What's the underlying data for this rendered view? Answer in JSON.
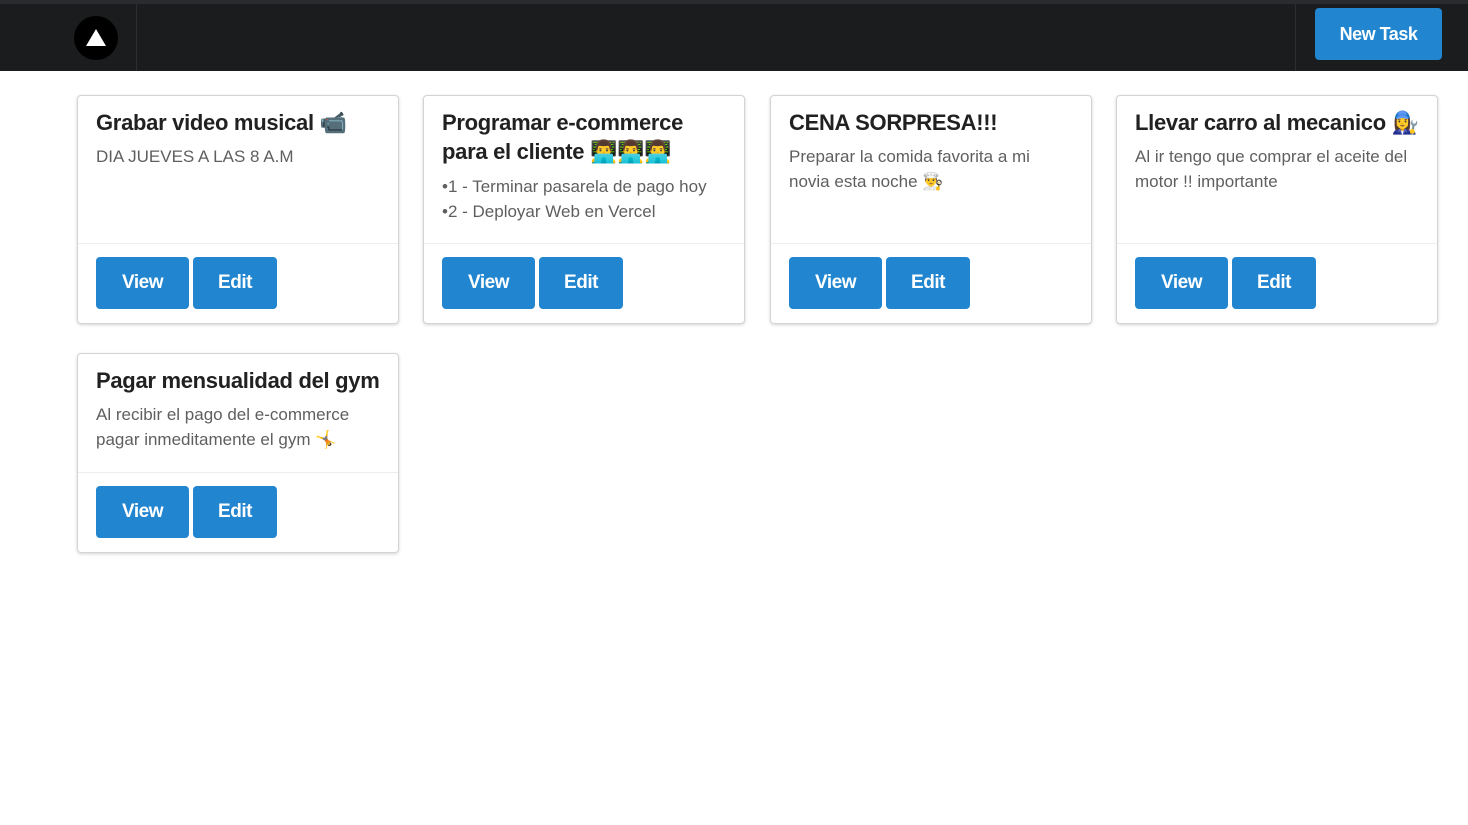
{
  "header": {
    "logo_icon": "triangle-logo-icon",
    "new_task_label": "New Task"
  },
  "colors": {
    "navbar": "#1b1c1d",
    "primary_button": "#2185d0"
  },
  "tasks": [
    {
      "title": "Grabar video musical 📹",
      "description_lines": [
        "DIA JUEVES A LAS 8 A.M"
      ],
      "view_label": "View",
      "edit_label": "Edit"
    },
    {
      "title": "Programar e-commerce para el cliente 👨‍💻👨‍💻👨‍💻",
      "list_items": [
        "1 - Terminar pasarela de pago hoy",
        "2 - Deployar Web en Vercel"
      ],
      "view_label": "View",
      "edit_label": "Edit"
    },
    {
      "title": "CENA SORPRESA!!!",
      "description_lines": [
        "Preparar la comida favorita a mi novia esta noche 👨‍🍳"
      ],
      "view_label": "View",
      "edit_label": "Edit"
    },
    {
      "title": "Llevar carro al mecanico 👩‍🔧",
      "description_lines": [
        "Al ir tengo que comprar el aceite del motor !! importante"
      ],
      "view_label": "View",
      "edit_label": "Edit"
    },
    {
      "title": "Pagar mensualidad del gym",
      "description_lines": [
        "Al recibir el pago del e-commerce pagar inmeditamente el gym 🤸"
      ],
      "view_label": "View",
      "edit_label": "Edit"
    }
  ]
}
